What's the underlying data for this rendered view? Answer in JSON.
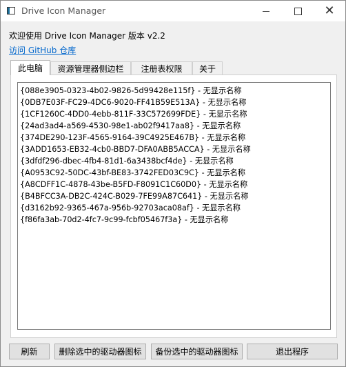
{
  "window": {
    "title": "Drive Icon Manager",
    "controls": {
      "minimize": "",
      "maximize": "",
      "close": "✕"
    }
  },
  "header": {
    "welcome_text": "欢迎使用 Drive Icon Manager 版本 v2.2",
    "github_link": "访问 GitHub 仓库"
  },
  "tabs": [
    {
      "label": "此电脑",
      "active": true
    },
    {
      "label": "资源管理器侧边栏",
      "active": false
    },
    {
      "label": "注册表权限",
      "active": false
    },
    {
      "label": "关于",
      "active": false
    }
  ],
  "list": {
    "items": [
      "{088e3905-0323-4b02-9826-5d99428e115f} - 无显示名称",
      "{0DB7E03F-FC29-4DC6-9020-FF41B59E513A} - 无显示名称",
      "{1CF1260C-4DD0-4ebb-811F-33C572699FDE} - 无显示名称",
      "{24ad3ad4-a569-4530-98e1-ab02f9417aa8} - 无显示名称",
      "{374DE290-123F-4565-9164-39C4925E467B} - 无显示名称",
      "{3ADD1653-EB32-4cb0-BBD7-DFA0ABB5ACCA} - 无显示名称",
      "{3dfdf296-dbec-4fb4-81d1-6a3438bcf4de} - 无显示名称",
      "{A0953C92-50DC-43bf-BE83-3742FED03C9C} - 无显示名称",
      "{A8CDFF1C-4878-43be-B5FD-F8091C1C60D0} - 无显示名称",
      "{B4BFCC3A-DB2C-424C-B029-7FE99A87C641} - 无显示名称",
      "{d3162b92-9365-467a-956b-92703aca08af} - 无显示名称",
      "{f86fa3ab-70d2-4fc7-9c99-fcbf05467f3a} - 无显示名称"
    ]
  },
  "buttons": {
    "refresh": "刷新",
    "delete_selected": "删除选中的驱动器图标",
    "backup_selected": "备份选中的驱动器图标",
    "exit": "退出程序"
  }
}
